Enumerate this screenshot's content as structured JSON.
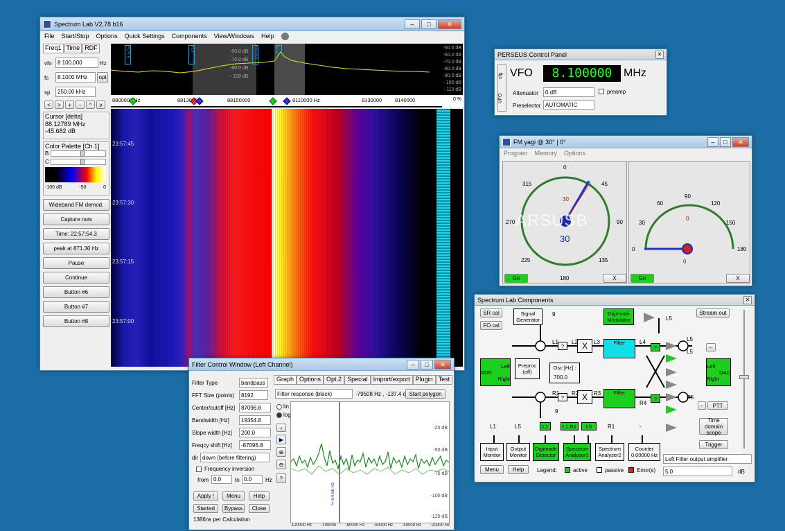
{
  "spectrum": {
    "title": "Spectrum Lab V2.78 b16",
    "menu": [
      "File",
      "Start/Stop",
      "Options",
      "Quick Settings",
      "Components",
      "View/Windows",
      "Help"
    ],
    "tabs": [
      "Freq1",
      "Time",
      "RDF"
    ],
    "vfo_label": "vfo",
    "vfo_value": "8 100.000",
    "vfo_unit": "Hz",
    "fc_label": "fc",
    "fc_value": "8.1000 MHz",
    "fc_btn": "opt",
    "sp_label": "sp",
    "sp_value": "250.00 kHz",
    "nav": [
      "<",
      ">",
      "+",
      "-",
      "^",
      "v"
    ],
    "cursor_title": "Cursor [delta]",
    "cursor_freq": "88.12789 MHz",
    "cursor_db": "-45.682 dB",
    "palette_title": "Color Palette [Ch 1]",
    "pal_b": "B",
    "pal_c": "C",
    "pal_scale": [
      "-100 dB",
      "-50",
      "0"
    ],
    "buttons": [
      "Wideband FM demod.",
      "Capture now",
      "Time:  22:57:54.3",
      "peak at 871.30 Hz",
      "Pause",
      "Continue",
      "Button #6",
      "Button #7",
      "Button #8"
    ],
    "db_scale": [
      "-50.0 dB",
      "-60.0 dB",
      "-70.0 dB",
      "-80.0 dB",
      "-90.0 dB",
      "- 100 dB",
      "- 110 dB"
    ],
    "db_scale_left": [
      "-50.0 dB",
      "-70.0 dB",
      "-80.0 dB",
      "- 100 dB"
    ],
    "freq_scale": [
      "8800000 Hz",
      "88130000",
      "88150000",
      "8110000 Hz",
      "8130000",
      "8140000"
    ],
    "freq_end": "0  %",
    "time_marks": [
      "23:57:45",
      "23:57:30",
      "23:57:15",
      "23:57:00"
    ],
    "markers": [
      "AOR 6",
      "FLT",
      "FRTRX",
      "T"
    ]
  },
  "perseus": {
    "title": "PERSEUS Control Panel",
    "side_tabs": [
      "VFO",
      "cfg"
    ],
    "vfo_label": "VFO",
    "freq": "8.100000",
    "unit": "MHz",
    "att_label": "Attenuator",
    "att_value": "0 dB",
    "preamp": "preamp",
    "presel_label": "Preselector",
    "presel_value": "AUTOMATIC"
  },
  "fmyagi": {
    "title": "FM yagi @ 30° | 0°",
    "menu": [
      "Program",
      "Memory",
      "Options"
    ],
    "az_ticks": [
      "0",
      "45",
      "90",
      "135",
      "180",
      "225",
      "270",
      "315"
    ],
    "az_value": "30",
    "az_red": "30",
    "watermark": "ARSUSB",
    "el_ticks": [
      "0",
      "30",
      "60",
      "90",
      "120",
      "150",
      "180"
    ],
    "el_red": "0",
    "el_value": "0",
    "go": "Go",
    "x": "X"
  },
  "components": {
    "title": "Spectrum Lab  Components",
    "sr_cal": "SR cal",
    "fo_cal": "FO cal",
    "siggen": "Signal Generator",
    "digimod": "Digimode Modulator",
    "stream": "Stream out",
    "sdr_l": "Left",
    "sdr_m": "SDR",
    "sdr_r": "Right",
    "preproc": "Preproc (off)",
    "osc": "Osc [Hz] :",
    "osc_val": "700.0",
    "filter": "Filter",
    "dac_l": "Left",
    "dac_m": "DAC",
    "dac_r": "Right",
    "ptt": "PTT",
    "time_scope": "Time domain scope",
    "trigger": "Trigger",
    "labels": [
      "L1",
      "L2",
      "L3",
      "L4",
      "L5",
      "R1",
      "R2",
      "R3",
      "R4",
      "R5",
      "9",
      "9",
      "L5",
      "L5"
    ],
    "top_labels": [
      "L1",
      "L5",
      "L1",
      "L1,R1",
      "L5",
      "R1",
      "-"
    ],
    "bottom": [
      "Input Monitor",
      "Output Monitor",
      "Digimode Detector",
      "Spectrum Analyser1",
      "Spectrum Analyser2",
      "Counter 0.00000 Hz"
    ],
    "menu_btn": "Menu",
    "help_btn": "Help",
    "legend": "Legend:",
    "active": "active",
    "passive": "passive",
    "errors": "Error(s)",
    "dropdown": "Left Filter output amplifier",
    "value": "5.0",
    "unit": "dB",
    "q": "?",
    "x": "X",
    "minus": "-",
    "dash": "--"
  },
  "filter": {
    "title": "Filter Control Window (Left Channel)",
    "rows": [
      {
        "label": "Filter Type",
        "value": "bandpass"
      },
      {
        "label": "FFT Size (points)",
        "value": "8192"
      },
      {
        "label": "Center/cutoff [Hz]",
        "value": "87096.8"
      },
      {
        "label": "Bandwidth [Hz]",
        "value": "19354.8"
      },
      {
        "label": "Slope width [Hz]",
        "value": "200.0"
      },
      {
        "label": "Freqcy shift [Hz]",
        "value": "-87096.8"
      }
    ],
    "dir": "dir",
    "dir_value": "down (before filtering)",
    "inversion": "Frequency inversion",
    "from": "from",
    "from_val": "0.0",
    "to": "to",
    "to_val": "0.0",
    "hz": "Hz",
    "buttons": [
      "Apply !",
      "Menu",
      "Help",
      "Started",
      "Bypass",
      "Close"
    ],
    "status": "1386ns per Calculation",
    "tabs": [
      "Graph",
      "Options",
      "Opt.2",
      "Special",
      "Import/export",
      "Plugin",
      "Test"
    ],
    "response": "Filter response (black)",
    "readout": "-79508  Hz , -137.4 dB",
    "start_poly": "Start polygon",
    "lin": "lin",
    "log": "log",
    "db_ticks": [
      "-25 dB",
      "-50 dB",
      "-75 dB",
      "-100 dB",
      "-125 dB"
    ],
    "x_ticks": [
      "-120000 Hz",
      "-100000",
      "-80000 Hz",
      "-60000 Hz",
      "-40000 Hz",
      "-20000 Hz"
    ],
    "marker": "f=-87096 Hz"
  }
}
